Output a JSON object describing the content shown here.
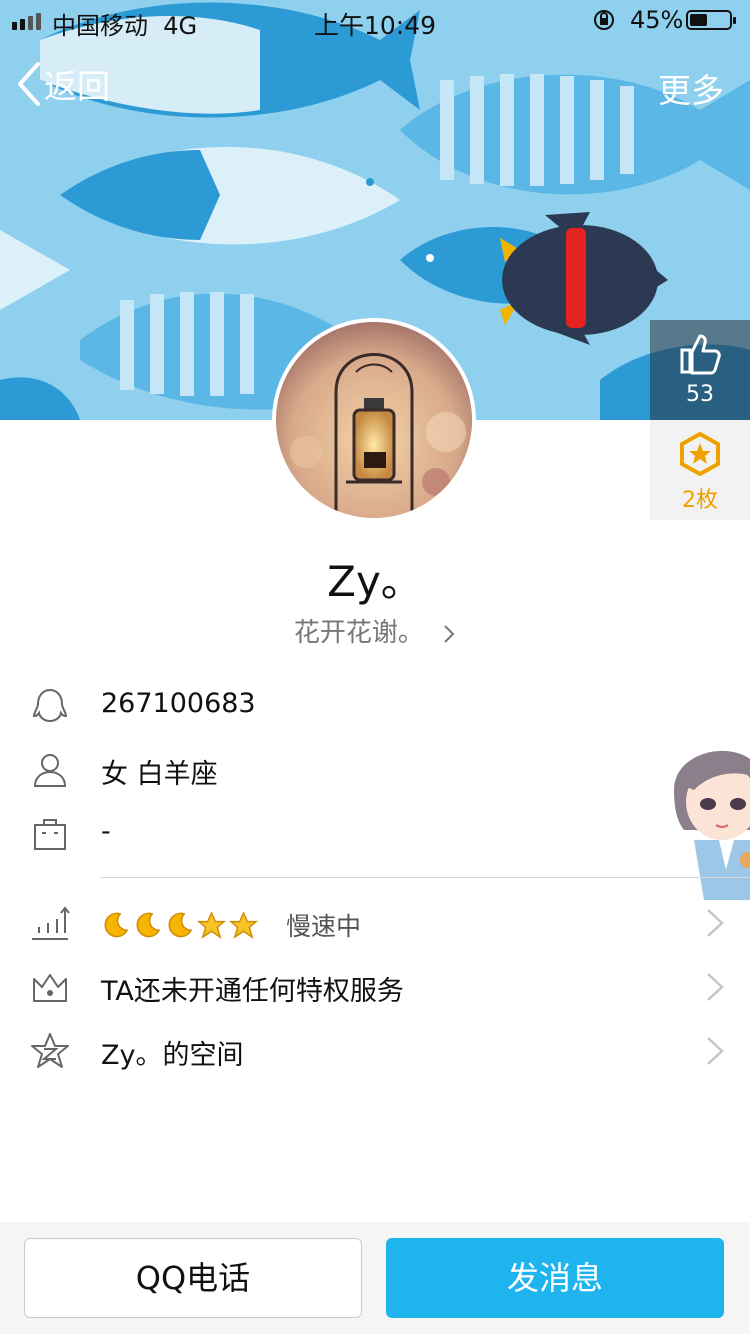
{
  "status_bar": {
    "carrier": "中国移动",
    "network": "4G",
    "time": "上午10:49",
    "battery_percent": "45%",
    "battery_level": 0.45
  },
  "nav": {
    "back_label": "返回",
    "more_label": "更多"
  },
  "side": {
    "like_count": "53",
    "badge_count": "2枚"
  },
  "profile": {
    "name": "Zy。",
    "signature": "花开花谢。"
  },
  "info": {
    "qq_number": "267100683",
    "gender_sign": "女 白羊座",
    "work": "-"
  },
  "links": {
    "level_status": "慢速中",
    "privilege": "TA还未开通任何特权服务",
    "space": "Zy。的空间"
  },
  "level_icons": [
    "moon-icon",
    "moon-icon",
    "moon-icon",
    "star-icon",
    "star-icon"
  ],
  "buttons": {
    "call": "QQ电话",
    "message": "发消息"
  },
  "colors": {
    "header_bg": "#7fc3e8",
    "primary": "#20b4ef",
    "badge_gold": "#f0a100"
  }
}
